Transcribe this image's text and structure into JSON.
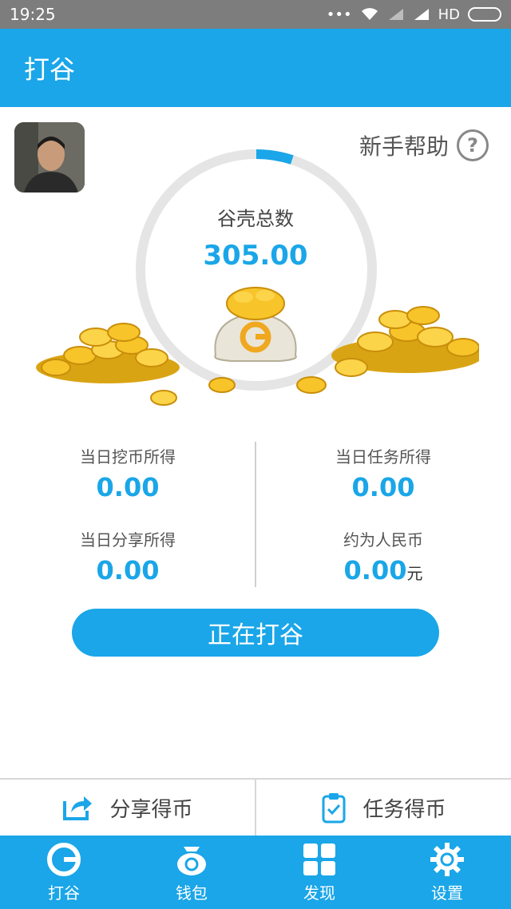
{
  "status_bar": {
    "time": "19:25",
    "dots": "•••",
    "network": "HD"
  },
  "app_bar": {
    "title": "打谷"
  },
  "help": {
    "label": "新手帮助",
    "icon": "?"
  },
  "summary": {
    "label": "谷壳总数",
    "value": "305.00",
    "progress": 0.05
  },
  "stats": {
    "mining": {
      "label": "当日挖币所得",
      "value": "0.00"
    },
    "task": {
      "label": "当日任务所得",
      "value": "0.00"
    },
    "share": {
      "label": "当日分享所得",
      "value": "0.00"
    },
    "rmb": {
      "label": "约为人民币",
      "value": "0.00",
      "unit": "元"
    }
  },
  "main_button": {
    "label": "正在打谷"
  },
  "actions": [
    {
      "label": "分享得币",
      "icon": "share-icon"
    },
    {
      "label": "任务得币",
      "icon": "clipboard-check-icon"
    }
  ],
  "tabs": [
    {
      "label": "打谷",
      "icon": "g-logo-icon"
    },
    {
      "label": "钱包",
      "icon": "money-bag-icon"
    },
    {
      "label": "发现",
      "icon": "grid-icon"
    },
    {
      "label": "设置",
      "icon": "gear-icon"
    }
  ],
  "colors": {
    "accent": "#1aa6e8",
    "status_bar": "#7d7d7d",
    "gold": "#f5b820"
  }
}
